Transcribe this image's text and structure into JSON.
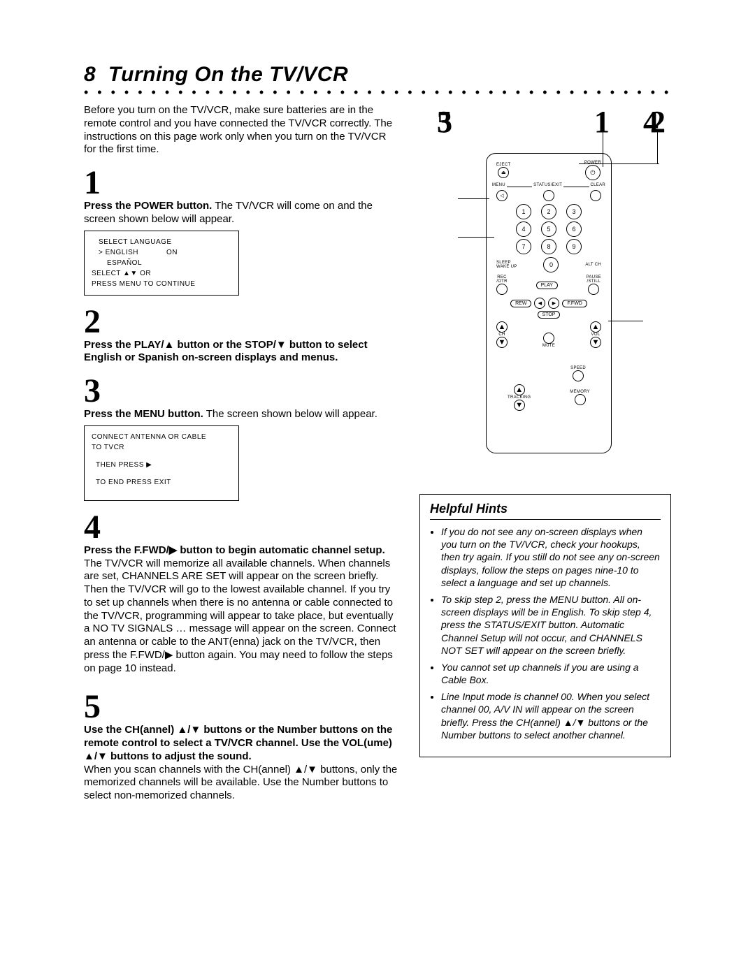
{
  "page_number": "8",
  "title": "Turning On the TV/VCR",
  "intro": "Before you turn on the TV/VCR, make sure batteries are in the remote control and you have connected the TV/VCR correctly. The instructions on this page work only when you turn on the TV/VCR for the first time.",
  "steps": {
    "s1": {
      "num": "1",
      "bold": "Press the POWER button.",
      "text": " The TV/VCR will come on and the screen shown below will appear."
    },
    "s2": {
      "num": "2",
      "bold": "Press the PLAY/▲ button or the STOP/▼ button to select English or Spanish on-screen displays and menus."
    },
    "s3": {
      "num": "3",
      "bold": "Press the MENU button.",
      "text": " The screen shown below will appear."
    },
    "s4": {
      "num": "4",
      "bold": "Press the F.FWD/▶ button to begin automatic channel setup.",
      "text": " The TV/VCR will memorize all available channels. When channels are set, CHANNELS ARE SET will appear on the screen briefly. Then the TV/VCR will go to the lowest available channel. If you try to set up channels when there is no antenna or cable connected to the TV/VCR, programming will appear to take place, but eventually a NO TV SIGNALS … message will appear on the screen. Connect an antenna or cable to the ANT(enna) jack on the TV/VCR, then press the F.FWD/▶ button again. You may need to follow the steps on page 10 instead."
    },
    "s5": {
      "num": "5",
      "bold": "Use the CH(annel) ▲/▼ buttons or the Number buttons on the remote control to select a TV/VCR channel. Use the VOL(ume) ▲/▼ buttons to adjust the sound.",
      "text2": "When you scan channels with the CH(annel) ▲/▼ buttons, only the memorized channels will be available. Use the Number buttons to select non-memorized channels."
    }
  },
  "screen1": {
    "l1": "SELECT LANGUAGE",
    "l2a": "> ENGLISH",
    "l2b": "ON",
    "l3": "ESPAÑOL",
    "l4": "SELECT ▲▼ OR",
    "l5": "PRESS MENU TO CONTINUE"
  },
  "screen2": {
    "l1": "CONNECT ANTENNA OR CABLE",
    "l2": "TO TVCR",
    "l3": "THEN PRESS ▶",
    "l4": "TO END PRESS EXIT"
  },
  "diagram_labels": {
    "d1": "1",
    "d2": "2",
    "d3": "3",
    "d4": "4",
    "d5": "5"
  },
  "remote": {
    "eject": "EJECT",
    "power": "POWER",
    "menu": "MENU",
    "status": "STATUS/EXIT",
    "clear": "CLEAR",
    "n1": "1",
    "n2": "2",
    "n3": "3",
    "n4": "4",
    "n5": "5",
    "n6": "6",
    "n7": "7",
    "n8": "8",
    "n9": "9",
    "n0": "0",
    "sleep": "SLEEP\nWAKE UP",
    "altch": "ALT CH",
    "rec": "REC\n/OTR",
    "play": "PLAY",
    "pause": "PAUSE\n/STILL",
    "rew": "REW",
    "ffwd": "F.FWD",
    "stop": "STOP",
    "ch": "CH",
    "vol": "VOL",
    "mute": "MUTE",
    "speed": "SPEED",
    "tracking": "TRACKING",
    "memory": "MEMORY",
    "up": "▲",
    "down": "▼",
    "left": "◀",
    "right": "▶"
  },
  "hints": {
    "title": "Helpful Hints",
    "h1": "If you do not see any on-screen displays when you turn on the TV/VCR, check your hookups, then try again. If you still do not see any on-screen displays, follow the steps on pages nine-10 to select a language and set up channels.",
    "h2": "To skip step 2, press the MENU button. All on-screen displays will be in English. To skip step 4, press the STATUS/EXIT button. Automatic Channel Setup will not occur, and CHANNELS NOT SET will appear on the screen briefly.",
    "h3": "You cannot set up channels if you are using a Cable Box.",
    "h4": "Line Input mode is channel 00. When you select channel 00, A/V IN will appear on the screen briefly. Press the CH(annel) ▲/▼ buttons or the Number buttons to select another channel."
  }
}
